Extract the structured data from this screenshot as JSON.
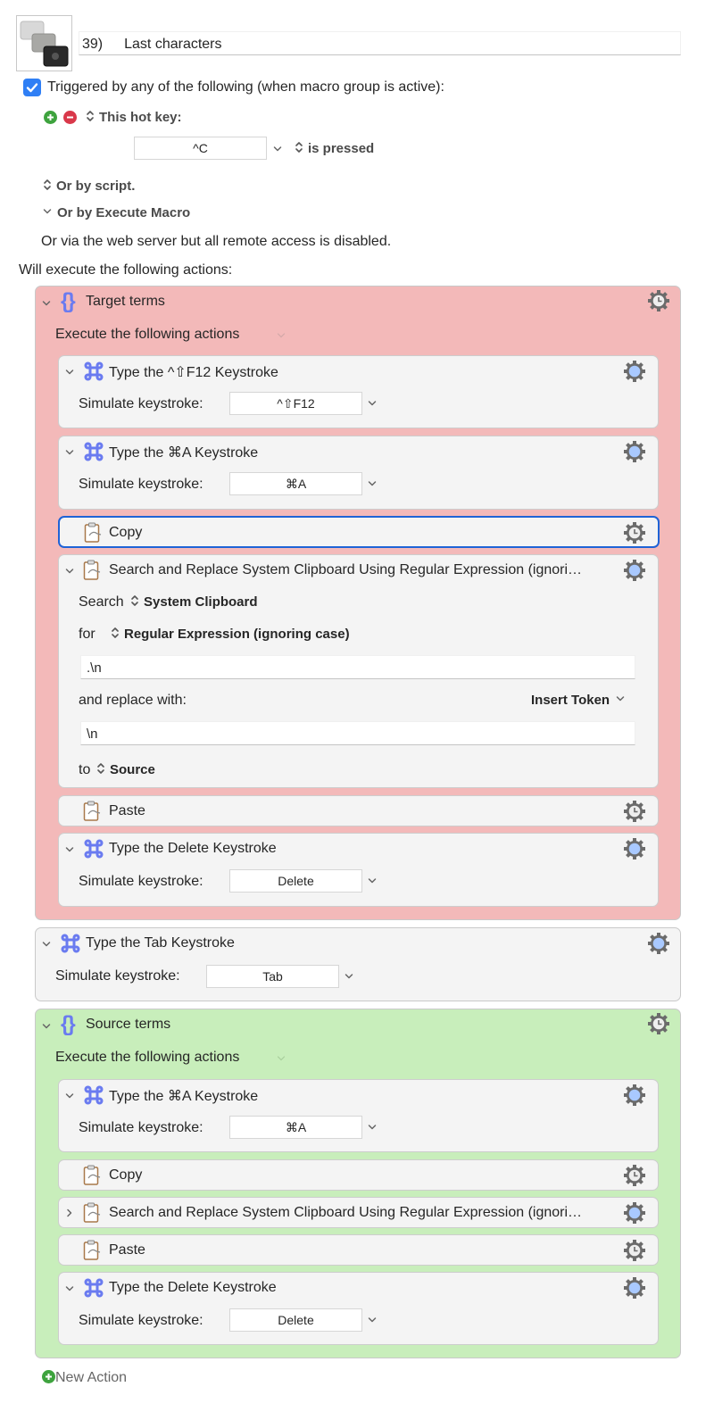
{
  "macro": {
    "number": "39)",
    "name": "Last characters",
    "triggered_checkbox_checked": true,
    "triggered_label": "Triggered by any of the following (when macro group is active):",
    "hotkey_label": "This hot key:",
    "hotkey_value": "^C",
    "hotkey_condition": "is pressed",
    "script_label": "Or by script.",
    "execute_macro_label": "Or by Execute Macro",
    "web_server_label": "Or via the web server but all remote access is disabled.",
    "will_execute_label": "Will execute the following actions:"
  },
  "common": {
    "execute_following": "Execute the following actions",
    "simulate_keystroke": "Simulate keystroke:",
    "new_action": "New Action"
  },
  "groups": {
    "target": {
      "title": "Target terms",
      "color": "#f3b9b9",
      "actions": {
        "a1": {
          "title": "Type the ^⇧F12 Keystroke",
          "keystroke": "^⇧F12"
        },
        "a2": {
          "title": "Type the ⌘A Keystroke",
          "keystroke": "⌘A"
        },
        "a3": {
          "title": "Copy"
        },
        "a4": {
          "title": "Search and Replace System Clipboard Using Regular Expression (ignori…",
          "search_label": "Search",
          "search_source": "System Clipboard",
          "for_label": "for",
          "for_mode": "Regular Expression (ignoring case)",
          "search_value": ".\\n",
          "replace_label": "and replace with:",
          "insert_token": "Insert Token",
          "replace_value": "\\n",
          "to_label": "to",
          "to_dest": "Source"
        },
        "a5": {
          "title": "Paste"
        },
        "a6": {
          "title": "Type the Delete Keystroke",
          "keystroke": "Delete"
        }
      }
    },
    "tab": {
      "title": "Type the Tab Keystroke",
      "keystroke": "Tab"
    },
    "source": {
      "title": "Source terms",
      "color": "#c8eebb",
      "actions": {
        "a1": {
          "title": "Type the ⌘A Keystroke",
          "keystroke": "⌘A"
        },
        "a2": {
          "title": "Copy"
        },
        "a3": {
          "title": "Search and Replace System Clipboard Using Regular Expression (ignori…"
        },
        "a4": {
          "title": "Paste"
        },
        "a5": {
          "title": "Type the Delete Keystroke",
          "keystroke": "Delete"
        }
      }
    }
  },
  "colors": {
    "selection_border": "#1f63d6",
    "checkbox": "#2f7ff5",
    "add_green": "#3ea33e",
    "remove_red": "#d9384a",
    "icon_blue": "#6a7bf0"
  }
}
